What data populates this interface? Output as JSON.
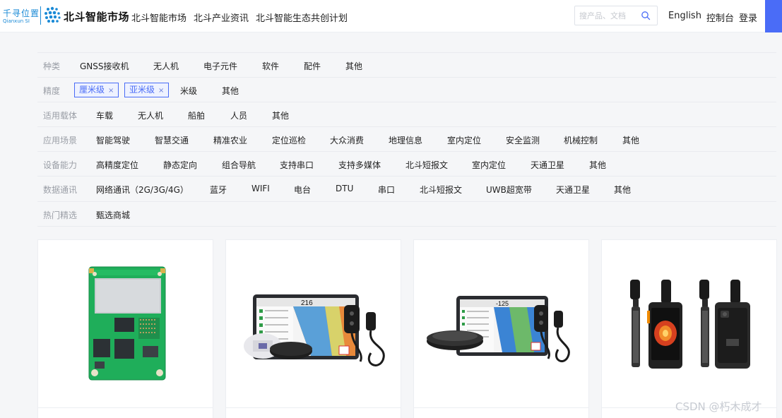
{
  "header": {
    "logo_a_cn": "千寻位置",
    "logo_a_en": "Qianxun SI",
    "logo_b": "北斗智能市场",
    "nav": [
      "北斗智能市场",
      "北斗产业资讯",
      "北斗智能生态共创计划"
    ],
    "search_placeholder": "搜产品、文档",
    "search_icon": "search-icon",
    "english": "English",
    "console": "控制台",
    "login": "登录",
    "accent": "#4a6cf7"
  },
  "filters": [
    {
      "label": "种类",
      "options": [
        "GNSS接收机",
        "无人机",
        "电子元件",
        "软件",
        "配件",
        "其他"
      ]
    },
    {
      "label": "精度",
      "selected": [
        "厘米级",
        "亚米级"
      ],
      "remove_icon": "×",
      "options": [
        "米级",
        "其他"
      ]
    },
    {
      "label": "适用载体",
      "options": [
        "车载",
        "无人机",
        "船舶",
        "人员",
        "其他"
      ]
    },
    {
      "label": "应用场景",
      "options": [
        "智能驾驶",
        "智慧交通",
        "精准农业",
        "定位巡检",
        "大众消费",
        "地理信息",
        "室内定位",
        "安全监测",
        "机械控制",
        "其他"
      ]
    },
    {
      "label": "设备能力",
      "options": [
        "高精度定位",
        "静态定向",
        "组合导航",
        "支持串口",
        "支持多媒体",
        "北斗短报文",
        "室内定位",
        "天通卫星",
        "其他"
      ]
    },
    {
      "label": "数据通讯",
      "options": [
        "网络通讯（2G/3G/4G）",
        "蓝牙",
        "WIFI",
        "电台",
        "DTU",
        "串口",
        "北斗短报文",
        "UWB超宽带",
        "天通卫星",
        "其他"
      ]
    },
    {
      "label": "热门精选",
      "options": [
        "甄选商城"
      ]
    }
  ],
  "products": [
    {
      "image": "gnss-module-board",
      "tablet_readout": ""
    },
    {
      "image": "agri-navigation-kit",
      "tablet_readout": "216"
    },
    {
      "image": "agri-navigation-kit-2",
      "tablet_readout": "-125"
    },
    {
      "image": "rugged-handheld-terminals",
      "tablet_readout": ""
    }
  ],
  "watermark": "CSDN @朽木成才"
}
